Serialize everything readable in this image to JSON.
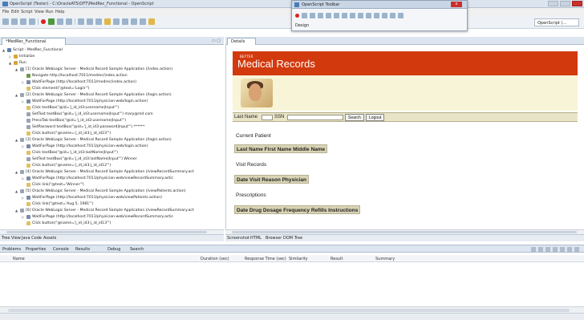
{
  "window": {
    "title": "OpenScript (Tester) - C:\\OracleATS\\OFT\\MedRec_Functional - OpenScript"
  },
  "menu": [
    "File",
    "Edit",
    "Script",
    "View",
    "Run",
    "Help"
  ],
  "perspective": "OpenScript (...",
  "floating_toolbar": {
    "title": "OpenScript Toolbar",
    "close": "x",
    "section": "Design"
  },
  "left_panel": {
    "tab": "*MedRec_Functional",
    "tree": [
      {
        "indent": 0,
        "twist": "▲",
        "icon": "script",
        "text": "Script - MedRec_Functional"
      },
      {
        "indent": 1,
        "twist": "▷",
        "icon": "step",
        "text": "Initialize"
      },
      {
        "indent": 1,
        "twist": "▲",
        "icon": "step",
        "text": "Run"
      },
      {
        "indent": 2,
        "twist": "▲",
        "icon": "field",
        "text": "[1] Oracle WebLogic Server - Medical Record Sample Application (/index.action)"
      },
      {
        "indent": 3,
        "twist": "",
        "icon": "nav",
        "text": "Navigate http://localhost:7011/medrec/index.action"
      },
      {
        "indent": 3,
        "twist": "▷",
        "icon": "wait",
        "text": "WaitForPage (http://localhost:7011/medrec/index.action)"
      },
      {
        "indent": 3,
        "twist": "",
        "icon": "click",
        "text": "Click element(\"@text='Login'\")"
      },
      {
        "indent": 2,
        "twist": "▲",
        "icon": "field",
        "text": "[2] Oracle WebLogic Server - Medical Record Sample Application (/login.action)"
      },
      {
        "indent": 3,
        "twist": "▷",
        "icon": "wait",
        "text": "WaitForPage (http://localhost:7011/physician-web/login.action)"
      },
      {
        "indent": 3,
        "twist": "",
        "icon": "click",
        "text": "Click textBox(\"@id='j_id_id3:username|Input'\")"
      },
      {
        "indent": 3,
        "twist": "",
        "icon": "field",
        "text": "SetText textBox(\"@id='j_id_id3:username|Input'\") mary@md.com"
      },
      {
        "indent": 3,
        "twist": "",
        "icon": "field",
        "text": "PressTab textBox(\"@id='j_id_id3:username|Input'\")"
      },
      {
        "indent": 3,
        "twist": "",
        "icon": "field",
        "text": "SetPassword textBox(\"@id='j_id_id3:password|Input'\") ******"
      },
      {
        "indent": 3,
        "twist": "",
        "icon": "click",
        "text": "Click button(\"@name='j_id_id3:j_id_id23'\")"
      },
      {
        "indent": 2,
        "twist": "▲",
        "icon": "field",
        "text": "[3] Oracle WebLogic Server - Medical Record Sample Application (/login.action)"
      },
      {
        "indent": 3,
        "twist": "▷",
        "icon": "wait",
        "text": "WaitForPage (http://localhost:7011/physician-web/login.action)"
      },
      {
        "indent": 3,
        "twist": "",
        "icon": "click",
        "text": "Click textBox(\"@id='j_id_id3:lastName|Input'\")"
      },
      {
        "indent": 3,
        "twist": "",
        "icon": "field",
        "text": "SetText textBox(\"@id='j_id_id3:lastName|Input'\") Winner"
      },
      {
        "indent": 3,
        "twist": "",
        "icon": "click",
        "text": "Click button(\"@name='j_id_id3:j_id_id12'\")"
      },
      {
        "indent": 2,
        "twist": "▲",
        "icon": "field",
        "text": "[4] Oracle WebLogic Server - Medical Record Sample Application (/viewRecordSummary.act"
      },
      {
        "indent": 3,
        "twist": "▷",
        "icon": "wait",
        "text": "WaitForPage (http://localhost:7011/physician-web/viewRecordSummary.actic"
      },
      {
        "indent": 3,
        "twist": "",
        "icon": "click",
        "text": "Click link(\"@text='Winner'\")"
      },
      {
        "indent": 2,
        "twist": "▲",
        "icon": "field",
        "text": "[5] Oracle WebLogic Server - Medical Record Sample Application (/viewPatients.action)"
      },
      {
        "indent": 3,
        "twist": "▷",
        "icon": "wait",
        "text": "WaitForPage (http://localhost:7011/physician-web/viewPatients.action)"
      },
      {
        "indent": 3,
        "twist": "",
        "icon": "click",
        "text": "Click link(\"@text='Aug 5, 1981'\")"
      },
      {
        "indent": 2,
        "twist": "▲",
        "icon": "field",
        "text": "[6] Oracle WebLogic Server - Medical Record Sample Application (/viewRecordSummary.act"
      },
      {
        "indent": 3,
        "twist": "▷",
        "icon": "wait",
        "text": "WaitForPage (http://localhost:7011/physician-web/viewRecordSummary.actic"
      },
      {
        "indent": 3,
        "twist": "",
        "icon": "click",
        "text": "Click button(\"@name='j_id_id3:j_id_id13'\")"
      }
    ],
    "bottom_tabs": [
      "Tree View",
      "Java Code",
      "Assets"
    ]
  },
  "right_panel": {
    "tab": "Details",
    "medrec": {
      "brand": "BEYTER",
      "title": "Medical Records",
      "search": {
        "last_name_label": "Last Name",
        "ssn_label": "SSN",
        "search_btn": "Search",
        "logout_btn": "Logout"
      },
      "sections": [
        {
          "label": "Current Patient",
          "header": "Last Name First Name Middle Name"
        },
        {
          "label": "Visit Records",
          "header": "Date Visit Reason Physician"
        },
        {
          "label": "Prescriptions",
          "header": "Date Drug Dosage Frequency Refills Instructions"
        }
      ]
    },
    "bottom_tabs": [
      "Screenshot",
      "HTML",
      "Browser",
      "DOM Tree"
    ]
  },
  "results": {
    "tabs": [
      "Problems",
      "Properties",
      "Console",
      "Results",
      "Debug",
      "Search"
    ],
    "columns": [
      "Name",
      "Duration (sec)",
      "Response Time (sec)",
      "Similarity",
      "Result",
      "Summary"
    ]
  }
}
